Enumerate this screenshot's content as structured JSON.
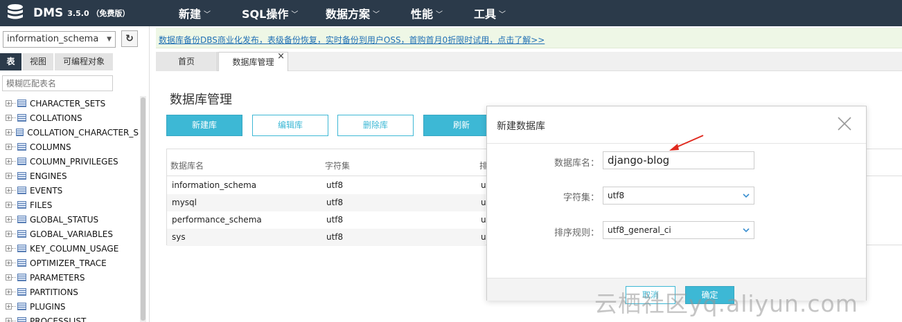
{
  "app": {
    "name": "DMS",
    "version": "3.5.0 （免费版）"
  },
  "nav": [
    {
      "label": "新建"
    },
    {
      "label": "SQL操作"
    },
    {
      "label": "数据方案"
    },
    {
      "label": "性能"
    },
    {
      "label": "工具"
    }
  ],
  "left": {
    "db_select": "information_schema",
    "tabs": [
      "表",
      "视图",
      "可编程对象"
    ],
    "filter_placeholder": "模糊匹配表名",
    "tables": [
      "CHARACTER_SETS",
      "COLLATIONS",
      "COLLATION_CHARACTER_S",
      "COLUMNS",
      "COLUMN_PRIVILEGES",
      "ENGINES",
      "EVENTS",
      "FILES",
      "GLOBAL_STATUS",
      "GLOBAL_VARIABLES",
      "KEY_COLUMN_USAGE",
      "OPTIMIZER_TRACE",
      "PARAMETERS",
      "PARTITIONS",
      "PLUGINS",
      "PROCESSLIST"
    ]
  },
  "notice": "数据库备份DBS商业化发布，表级备份恢复，实时备份到用户OSS，首购首月0折限时试用，点击了解>>",
  "tabs": [
    {
      "label": "首页"
    },
    {
      "label": "数据库管理",
      "close": "×"
    }
  ],
  "main": {
    "title": "数据库管理",
    "buttons": {
      "create": "新建库",
      "edit": "编辑库",
      "delete": "删除库",
      "refresh": "刷新"
    },
    "table": {
      "headers": [
        "数据库名",
        "字符集",
        "排"
      ],
      "rows": [
        [
          "information_schema",
          "utf8",
          "u"
        ],
        [
          "mysql",
          "utf8",
          "u"
        ],
        [
          "performance_schema",
          "utf8",
          "u"
        ],
        [
          "sys",
          "utf8",
          "u"
        ]
      ]
    }
  },
  "modal": {
    "title": "新建数据库",
    "name_label": "数据库名：",
    "name_value": "django-blog",
    "charset_label": "字符集：",
    "charset_value": "utf8",
    "collation_label": "排序规则：",
    "collation_value": "utf8_general_ci",
    "cancel": "取消",
    "ok": "确定"
  },
  "watermark": "云栖社区yq.aliyun.com",
  "colors": {
    "nav_bg": "#2b3a4a",
    "accent": "#3db8d5",
    "notice_bg": "#eef7e6",
    "arrow": "#e02a1f"
  }
}
